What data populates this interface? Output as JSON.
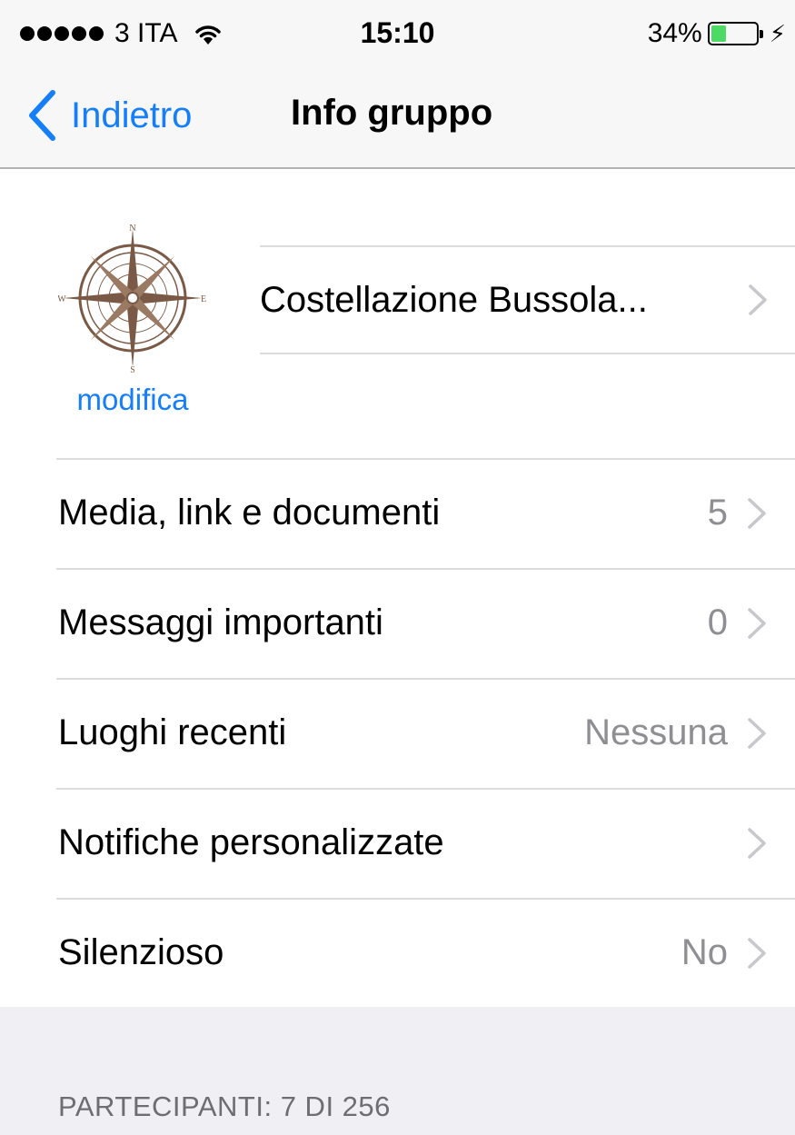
{
  "status_bar": {
    "carrier": "3 ITA",
    "time": "15:10",
    "battery_percent": "34%",
    "battery_level": 0.34,
    "battery_color": "#4cd964"
  },
  "nav": {
    "back_label": "Indietro",
    "title": "Info gruppo"
  },
  "group": {
    "name": "Costellazione Bussola...",
    "edit_label": "modifica",
    "avatar_icon": "compass-rose-icon"
  },
  "rows": [
    {
      "label": "Media, link e documenti",
      "value": "5"
    },
    {
      "label": "Messaggi importanti",
      "value": "0"
    },
    {
      "label": "Luoghi recenti",
      "value": "Nessuna"
    },
    {
      "label": "Notifiche personalizzate",
      "value": ""
    },
    {
      "label": "Silenzioso",
      "value": "No"
    }
  ],
  "participants_header": "PARTECIPANTI: 7 DI 256",
  "colors": {
    "accent": "#147efb",
    "separator": "#dcdcdc",
    "secondary_text": "#8e8e93",
    "grouped_background": "#efeff4"
  }
}
